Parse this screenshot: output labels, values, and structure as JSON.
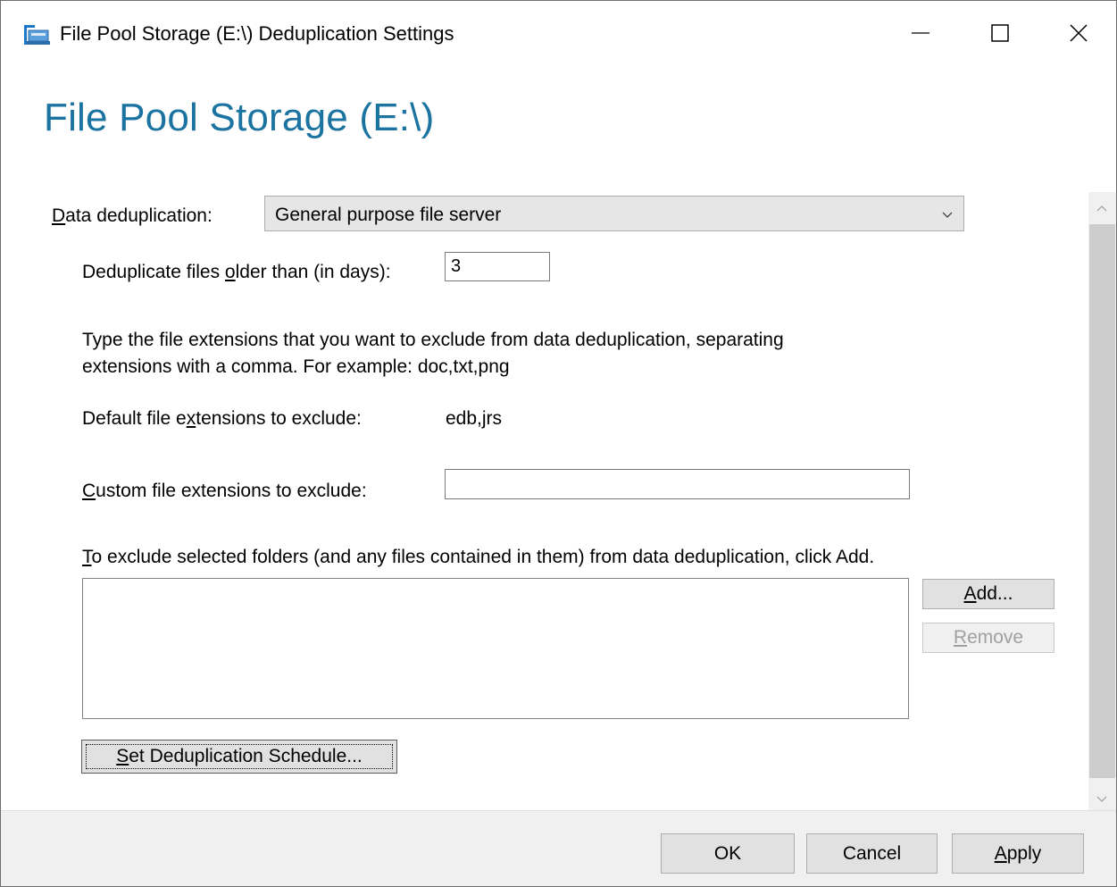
{
  "window": {
    "title": "File Pool Storage (E:\\) Deduplication Settings",
    "controls": {
      "minimize": "—",
      "maximize": "☐",
      "close": "✕"
    }
  },
  "page": {
    "heading": "File Pool Storage (E:\\)"
  },
  "dedup": {
    "label_prefix": "D",
    "label_rest": "ata deduplication:",
    "selected": "General purpose file server"
  },
  "age": {
    "label_a": "Deduplicate files ",
    "label_u": "o",
    "label_b": "lder than (in days):",
    "value": "3"
  },
  "instructions": {
    "line1": "Type the file extensions that you want to exclude from data deduplication, separating",
    "line2": "extensions with a comma. For example: doc,txt,png"
  },
  "default_ext": {
    "label_a": "Default file e",
    "label_u": "x",
    "label_b": "tensions to exclude:",
    "value": "edb,jrs"
  },
  "custom_ext": {
    "label_u": "C",
    "label_rest": "ustom file extensions to exclude:",
    "value": ""
  },
  "folders": {
    "label_u": "T",
    "label_rest": "o exclude selected folders (and any files contained in them) from data deduplication, click Add.",
    "items": []
  },
  "buttons": {
    "add_u": "A",
    "add_rest": "dd...",
    "remove_u": "R",
    "remove_rest": "emove",
    "schedule_u": "S",
    "schedule_rest": "et Deduplication Schedule...",
    "ok": "OK",
    "cancel": "Cancel",
    "apply_u": "A",
    "apply_rest": "pply"
  },
  "colors": {
    "heading": "#1a73a0",
    "button_face": "#e1e1e1",
    "footer": "#f0f0f0"
  },
  "icons": {
    "title": "storage-folder-icon",
    "dropdown": "chevron-down-icon",
    "scroll_up": "chevron-up-icon",
    "scroll_down": "chevron-down-icon"
  }
}
